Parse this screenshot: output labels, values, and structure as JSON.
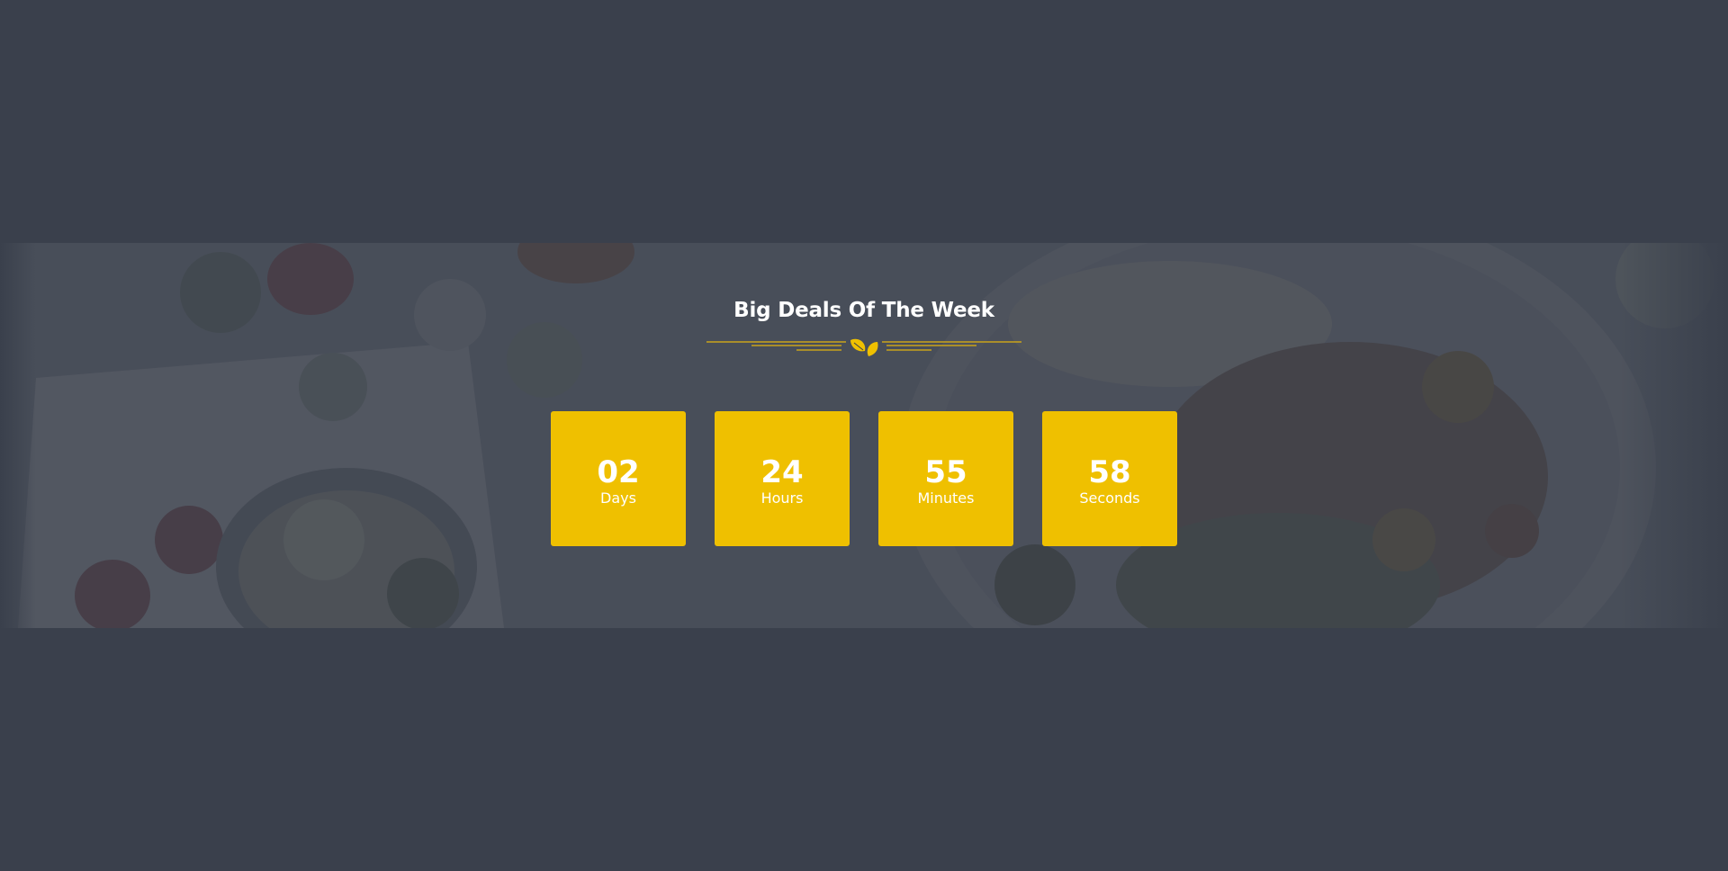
{
  "section": {
    "title": "Big Deals Of The Week",
    "divider_icon": "leaf-icon",
    "background": "food-photo"
  },
  "countdown": [
    {
      "value": "02",
      "unit": "Days"
    },
    {
      "value": "24",
      "unit": "Hours"
    },
    {
      "value": "55",
      "unit": "Minutes"
    },
    {
      "value": "58",
      "unit": "Seconds"
    }
  ],
  "colors": {
    "page_bg": "#3a404c",
    "accent": "#efc000",
    "text": "#ffffff"
  }
}
